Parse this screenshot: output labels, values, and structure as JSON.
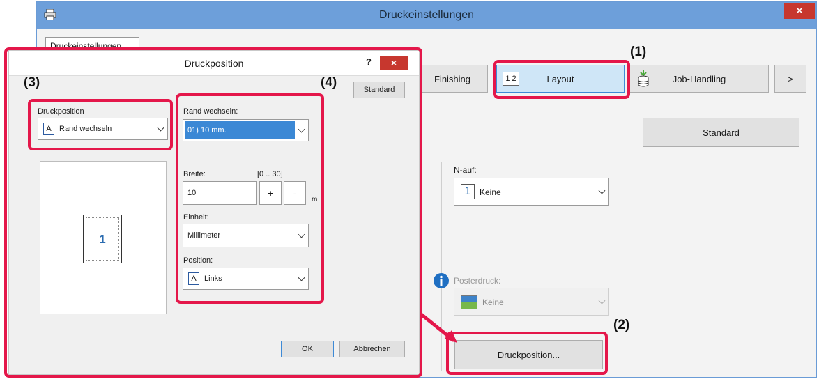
{
  "main_window": {
    "title": "Druckeinstellungen",
    "close": "×",
    "tab": "Druckeinstellungen",
    "tabs": [
      {
        "label": "Finishing"
      },
      {
        "label": "Layout",
        "icon_text": "1 2"
      },
      {
        "label": "Job-Handling"
      },
      {
        "label": ">"
      }
    ],
    "standard_button": "Standard",
    "n_up": {
      "label": "N-auf:",
      "value": "Keine",
      "icon_number": "1"
    },
    "poster": {
      "label": "Posterdruck:",
      "value": "Keine"
    },
    "print_position_button": "Druckposition..."
  },
  "dialog": {
    "title": "Druckposition",
    "help": "?",
    "close": "×",
    "standard_button": "Standard",
    "print_position": {
      "label": "Druckposition",
      "value": "Rand wechseln",
      "icon_letter": "A"
    },
    "preview_page_number": "1",
    "margin_shift": {
      "label": "Rand wechseln:",
      "value": "01) 10 mm."
    },
    "width": {
      "label": "Breite:",
      "range": "[0 .. 30]",
      "value": "10",
      "plus": "+",
      "minus": "-",
      "unit": "m"
    },
    "unit": {
      "label": "Einheit:",
      "value": "Millimeter"
    },
    "position": {
      "label": "Position:",
      "value": "Links",
      "icon_letter": "A"
    },
    "ok_button": "OK",
    "cancel_button": "Abbrechen"
  },
  "annotations": {
    "a1": "(1)",
    "a2": "(2)",
    "a3": "(3)",
    "a4": "(4)"
  },
  "colors": {
    "highlight": "#e4174a",
    "title_bar": "#6d9fda",
    "selected": "#3b88d5"
  }
}
